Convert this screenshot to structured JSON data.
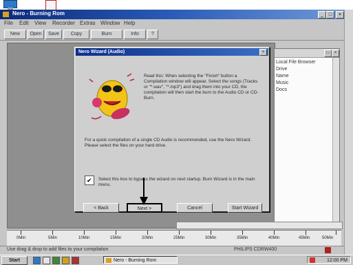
{
  "app": {
    "title": "Nero - Burning Rom",
    "menu": [
      "File",
      "Edit",
      "View",
      "Recorder",
      "Extras",
      "Window",
      "Help"
    ],
    "toolbar": [
      "New",
      "Open",
      "Save",
      "Copy",
      "Burn",
      "Info",
      "?"
    ]
  },
  "right_panel": {
    "lines": [
      "Local File Browser",
      "Drive",
      "Name",
      "Music",
      "Docs"
    ]
  },
  "dialog": {
    "title": "Nero Wizard (Audio)",
    "intro": "Read this: When selecting the \"Finish\" button a Compilation window will appear. Select the songs (Tracks or \"*.wav\", \"*.mp3\") and drag them into your CD, the compilation will then start the burn to the Audio CD or CD-Burn.",
    "note": "For a quick compilation of a single CD Audio is recommended, use the Nero Wizard. Please select the files on your hard drive.",
    "checkbox_label": "Select this box to bypass the wizard on next startup. Burn Wizard is in the main menu.",
    "checkbox_checked": true,
    "buttons": {
      "back": "< Back",
      "next": "Next >",
      "cancel": "Cancel",
      "finish": "Start Wizard"
    }
  },
  "ruler": {
    "labels": [
      "0Min",
      "5Min",
      "10Min",
      "15Min",
      "20Min",
      "25Min",
      "30Min",
      "35Min",
      "40Min",
      "45Min",
      "50Min"
    ]
  },
  "status": {
    "left": "Use drag & drop to add files to your compilation",
    "mid": "PHILIPS CDRW400"
  },
  "taskbar": {
    "start": "Start",
    "task": "Nero - Burning Rom",
    "clock": "12:00 PM"
  },
  "colors": {
    "title_bar": "#0a2a7a",
    "dialog_bg": "#cfcfcf",
    "workspace": "#8f8f8f"
  }
}
